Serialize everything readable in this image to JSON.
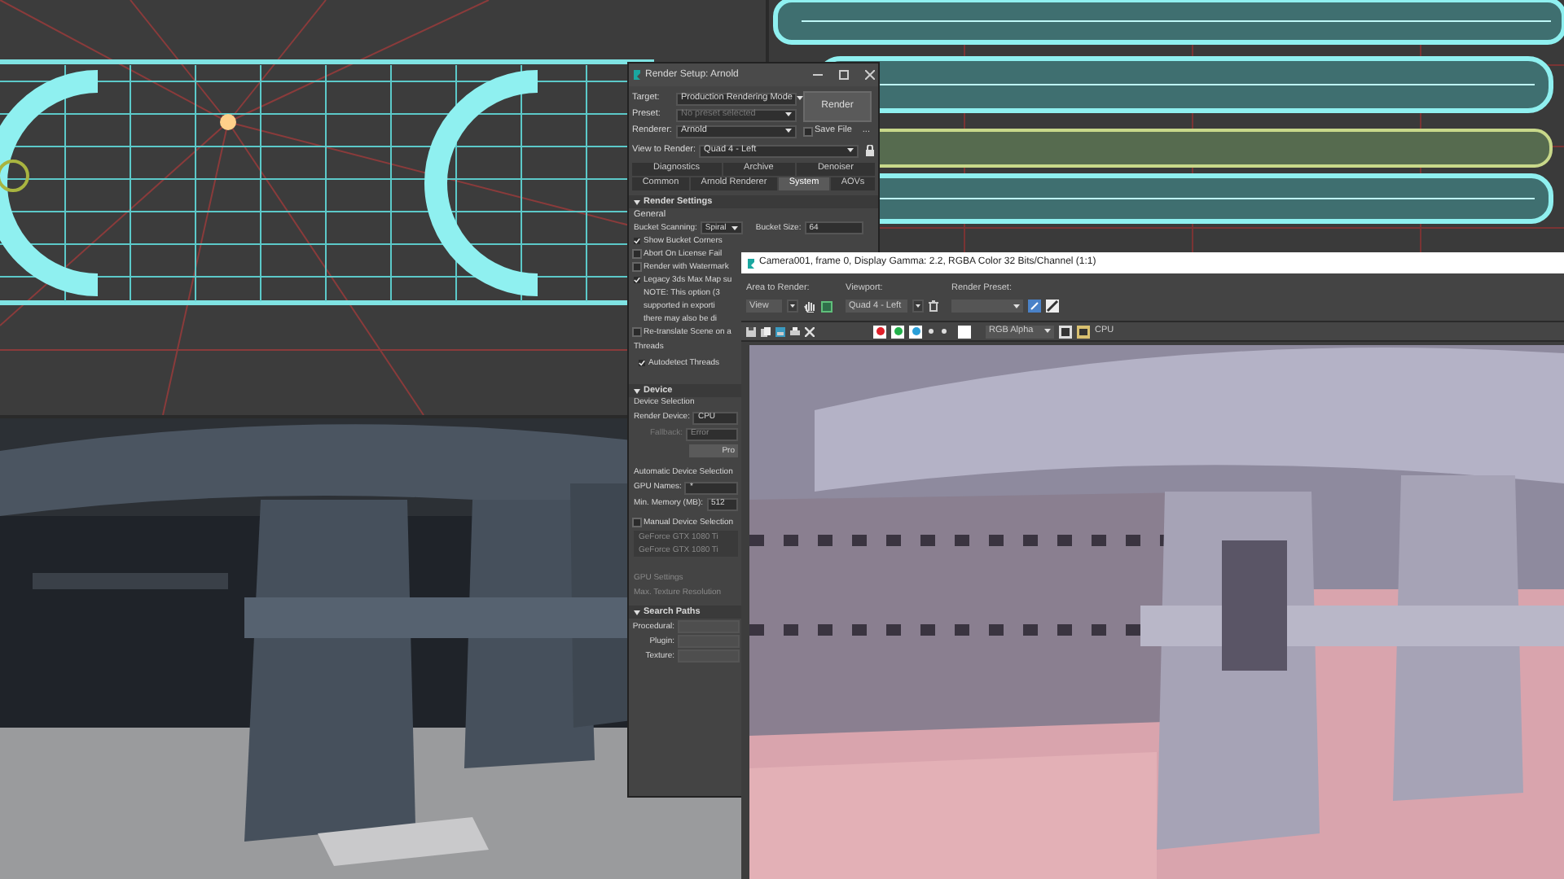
{
  "render_setup": {
    "title": "Render Setup: Arnold",
    "fields": [
      {
        "label": "Target:",
        "value": "Production Rendering Mode",
        "disabled": false
      },
      {
        "label": "Preset:",
        "value": "No preset selected",
        "disabled": true
      },
      {
        "label": "Renderer:",
        "value": "Arnold",
        "disabled": false
      }
    ],
    "render_button": "Render",
    "save_file": {
      "label": "Save File",
      "checked": false
    },
    "more_button": "...",
    "view_to_render": {
      "label": "View to Render:",
      "value": "Quad 4 - Left"
    },
    "tabs_row_1": [
      {
        "label": "Diagnostics",
        "selected": false
      },
      {
        "label": "Archive",
        "selected": false
      },
      {
        "label": "Denoiser",
        "selected": false
      }
    ],
    "tabs_row_2": [
      {
        "label": "Common",
        "selected": false
      },
      {
        "label": "Arnold Renderer",
        "selected": false
      },
      {
        "label": "System",
        "selected": true
      },
      {
        "label": "AOVs",
        "selected": false
      }
    ],
    "render_settings": {
      "title": "Render Settings",
      "general": "General",
      "bucket_scanning": {
        "label": "Bucket Scanning:",
        "value": "Spiral"
      },
      "bucket_size": {
        "label": "Bucket Size:",
        "value": "64"
      },
      "options": [
        {
          "label": "Show Bucket Corners",
          "checked": true
        },
        {
          "label": "Abort On License Fail",
          "checked": false
        },
        {
          "label": "Render with Watermark",
          "checked": false
        },
        {
          "label": "Legacy 3ds Max Map su",
          "checked": true
        }
      ],
      "note": [
        "NOTE: This option (3",
        "supported in exporti",
        "there may also be di"
      ],
      "retranslate": {
        "label": "Re-translate Scene on a",
        "checked": false
      },
      "threads": "Threads",
      "autodetect": {
        "label": "Autodetect Threads",
        "checked": true
      }
    },
    "device": {
      "title": "Device",
      "selection": "Device Selection",
      "render_device": {
        "label": "Render Device:",
        "value": "CPU"
      },
      "fallback": {
        "label": "Fallback:",
        "value": "Error",
        "disabled": true
      },
      "button": "Pro",
      "automatic": "Automatic Device Selection",
      "gpu_names": {
        "label": "GPU Names:",
        "value": "*"
      },
      "min_memory": {
        "label": "Min. Memory (MB):",
        "value": "512"
      },
      "manual": {
        "label": "Manual Device Selection",
        "checked": false
      },
      "gpus": [
        "GeForce GTX 1080 Ti",
        "GeForce GTX 1080 Ti"
      ],
      "gpu_settings": "GPU Settings",
      "max_texture": "Max. Texture Resolution"
    },
    "search_paths": {
      "title": "Search Paths",
      "fields": [
        "Procedural:",
        "Plugin:",
        "Texture:"
      ]
    }
  },
  "frame_buffer": {
    "title": "Camera001, frame 0, Display Gamma: 2.2, RGBA Color 32 Bits/Channel (1:1)",
    "area_to_render": {
      "label": "Area to Render:",
      "value": "View"
    },
    "viewport": {
      "label": "Viewport:",
      "value": "Quad 4 - Left"
    },
    "render_preset": {
      "label": "Render Preset:"
    },
    "channels": [
      {
        "color": "#e0202a"
      },
      {
        "color": "#22b04a"
      },
      {
        "color": "#2a9fd8"
      }
    ],
    "channel_display": "RGB Alpha",
    "device": "CPU"
  }
}
